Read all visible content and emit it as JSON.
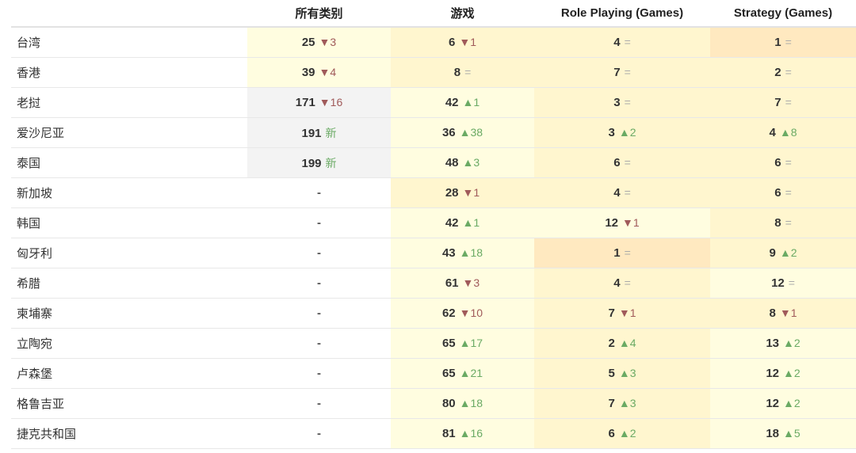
{
  "table": {
    "headers": [
      "",
      "所有类别",
      "游戏",
      "Role Playing (Games)",
      "Strategy (Games)"
    ],
    "rows": [
      {
        "country": "台湾",
        "cells": [
          {
            "rank": "25",
            "dir": "down",
            "change": "▼3",
            "shade": "y1"
          },
          {
            "rank": "6",
            "dir": "down",
            "change": "▼1",
            "shade": "y2"
          },
          {
            "rank": "4",
            "dir": "same",
            "change": "=",
            "shade": "y2"
          },
          {
            "rank": "1",
            "dir": "same",
            "change": "=",
            "shade": "y3"
          }
        ]
      },
      {
        "country": "香港",
        "cells": [
          {
            "rank": "39",
            "dir": "down",
            "change": "▼4",
            "shade": "y1"
          },
          {
            "rank": "8",
            "dir": "same",
            "change": "=",
            "shade": "y2"
          },
          {
            "rank": "7",
            "dir": "same",
            "change": "=",
            "shade": "y2"
          },
          {
            "rank": "2",
            "dir": "same",
            "change": "=",
            "shade": "y2"
          }
        ]
      },
      {
        "country": "老挝",
        "cells": [
          {
            "rank": "171",
            "dir": "down",
            "change": "▼16",
            "shade": "gray"
          },
          {
            "rank": "42",
            "dir": "up",
            "change": "▲1",
            "shade": "y1"
          },
          {
            "rank": "3",
            "dir": "same",
            "change": "=",
            "shade": "y2"
          },
          {
            "rank": "7",
            "dir": "same",
            "change": "=",
            "shade": "y2"
          }
        ]
      },
      {
        "country": "爱沙尼亚",
        "cells": [
          {
            "rank": "191",
            "dir": "new",
            "change": "新",
            "shade": "gray"
          },
          {
            "rank": "36",
            "dir": "up",
            "change": "▲38",
            "shade": "y1"
          },
          {
            "rank": "3",
            "dir": "up",
            "change": "▲2",
            "shade": "y2"
          },
          {
            "rank": "4",
            "dir": "up",
            "change": "▲8",
            "shade": "y2"
          }
        ]
      },
      {
        "country": "泰国",
        "cells": [
          {
            "rank": "199",
            "dir": "new",
            "change": "新",
            "shade": "gray"
          },
          {
            "rank": "48",
            "dir": "up",
            "change": "▲3",
            "shade": "y1"
          },
          {
            "rank": "6",
            "dir": "same",
            "change": "=",
            "shade": "y2"
          },
          {
            "rank": "6",
            "dir": "same",
            "change": "=",
            "shade": "y2"
          }
        ]
      },
      {
        "country": "新加坡",
        "cells": [
          {
            "rank": "-",
            "dir": "none",
            "change": "",
            "shade": "empty"
          },
          {
            "rank": "28",
            "dir": "down",
            "change": "▼1",
            "shade": "y2"
          },
          {
            "rank": "4",
            "dir": "same",
            "change": "=",
            "shade": "y2"
          },
          {
            "rank": "6",
            "dir": "same",
            "change": "=",
            "shade": "y2"
          }
        ]
      },
      {
        "country": "韩国",
        "cells": [
          {
            "rank": "-",
            "dir": "none",
            "change": "",
            "shade": "empty"
          },
          {
            "rank": "42",
            "dir": "up",
            "change": "▲1",
            "shade": "y1"
          },
          {
            "rank": "12",
            "dir": "down",
            "change": "▼1",
            "shade": "y1"
          },
          {
            "rank": "8",
            "dir": "same",
            "change": "=",
            "shade": "y2"
          }
        ]
      },
      {
        "country": "匈牙利",
        "cells": [
          {
            "rank": "-",
            "dir": "none",
            "change": "",
            "shade": "empty"
          },
          {
            "rank": "43",
            "dir": "up",
            "change": "▲18",
            "shade": "y1"
          },
          {
            "rank": "1",
            "dir": "same",
            "change": "=",
            "shade": "y3"
          },
          {
            "rank": "9",
            "dir": "up",
            "change": "▲2",
            "shade": "y2"
          }
        ]
      },
      {
        "country": "希腊",
        "cells": [
          {
            "rank": "-",
            "dir": "none",
            "change": "",
            "shade": "empty"
          },
          {
            "rank": "61",
            "dir": "down",
            "change": "▼3",
            "shade": "y1"
          },
          {
            "rank": "4",
            "dir": "same",
            "change": "=",
            "shade": "y2"
          },
          {
            "rank": "12",
            "dir": "same",
            "change": "=",
            "shade": "y1"
          }
        ]
      },
      {
        "country": "柬埔寨",
        "cells": [
          {
            "rank": "-",
            "dir": "none",
            "change": "",
            "shade": "empty"
          },
          {
            "rank": "62",
            "dir": "down",
            "change": "▼10",
            "shade": "y1"
          },
          {
            "rank": "7",
            "dir": "down",
            "change": "▼1",
            "shade": "y2"
          },
          {
            "rank": "8",
            "dir": "down",
            "change": "▼1",
            "shade": "y2"
          }
        ]
      },
      {
        "country": "立陶宛",
        "cells": [
          {
            "rank": "-",
            "dir": "none",
            "change": "",
            "shade": "empty"
          },
          {
            "rank": "65",
            "dir": "up",
            "change": "▲17",
            "shade": "y1"
          },
          {
            "rank": "2",
            "dir": "up",
            "change": "▲4",
            "shade": "y2"
          },
          {
            "rank": "13",
            "dir": "up",
            "change": "▲2",
            "shade": "y1"
          }
        ]
      },
      {
        "country": "卢森堡",
        "cells": [
          {
            "rank": "-",
            "dir": "none",
            "change": "",
            "shade": "empty"
          },
          {
            "rank": "65",
            "dir": "up",
            "change": "▲21",
            "shade": "y1"
          },
          {
            "rank": "5",
            "dir": "up",
            "change": "▲3",
            "shade": "y2"
          },
          {
            "rank": "12",
            "dir": "up",
            "change": "▲2",
            "shade": "y1"
          }
        ]
      },
      {
        "country": "格鲁吉亚",
        "cells": [
          {
            "rank": "-",
            "dir": "none",
            "change": "",
            "shade": "empty"
          },
          {
            "rank": "80",
            "dir": "up",
            "change": "▲18",
            "shade": "y1"
          },
          {
            "rank": "7",
            "dir": "up",
            "change": "▲3",
            "shade": "y2"
          },
          {
            "rank": "12",
            "dir": "up",
            "change": "▲2",
            "shade": "y1"
          }
        ]
      },
      {
        "country": "捷克共和国",
        "cells": [
          {
            "rank": "-",
            "dir": "none",
            "change": "",
            "shade": "empty"
          },
          {
            "rank": "81",
            "dir": "up",
            "change": "▲16",
            "shade": "y1"
          },
          {
            "rank": "6",
            "dir": "up",
            "change": "▲2",
            "shade": "y2"
          },
          {
            "rank": "18",
            "dir": "up",
            "change": "▲5",
            "shade": "y1"
          }
        ]
      }
    ]
  },
  "colors": {
    "up": "#6aaa64",
    "down": "#a05a5a",
    "same": "#aaaaaa",
    "shade_gray": "#f3f3f3",
    "shade_light_yellow": "#fffde0",
    "shade_yellow": "#fff6cf",
    "shade_orange": "#ffe9c0"
  }
}
